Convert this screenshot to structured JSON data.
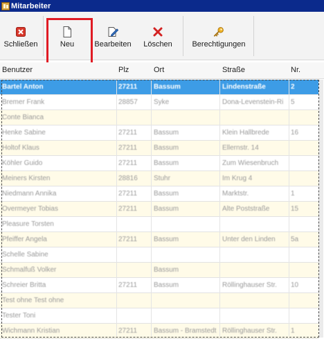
{
  "window": {
    "title": "Mitarbeiter"
  },
  "toolbar": {
    "close_label": "Schließen",
    "new_label": "Neu",
    "edit_label": "Bearbeiten",
    "delete_label": "Löschen",
    "permissions_label": "Berechtigungen"
  },
  "table": {
    "columns": [
      "Benutzer",
      "Plz",
      "Ort",
      "Straße",
      "Nr."
    ],
    "rows": [
      [
        "Bartel Anton",
        "27211",
        "Bassum",
        "Lindenstraße",
        "2"
      ],
      [
        "Bremer Frank",
        "28857",
        "Syke",
        "Dona-Levenstein-Ri",
        "5"
      ],
      [
        "Conte Bianca",
        "",
        "",
        "",
        ""
      ],
      [
        "Henke Sabine",
        "27211",
        "Bassum",
        "Klein Hallbrede",
        "16"
      ],
      [
        "Holtof Klaus",
        "27211",
        "Bassum",
        "Ellernstr. 14",
        ""
      ],
      [
        "Köhler Guido",
        "27211",
        "Bassum",
        "Zum Wiesenbruch",
        ""
      ],
      [
        "Meiners Kirsten",
        "28816",
        "Stuhr",
        "Im Krug 4",
        ""
      ],
      [
        "Niedmann Annika",
        "27211",
        "Bassum",
        "Marktstr.",
        "1"
      ],
      [
        "Overmeyer Tobias",
        "27211",
        "Bassum",
        "Alte Poststraße",
        "15"
      ],
      [
        "Pleasure Torsten",
        "",
        "",
        "",
        ""
      ],
      [
        "Pfeiffer Angela",
        "27211",
        "Bassum",
        "Unter den Linden",
        "5a"
      ],
      [
        "Schelle Sabine",
        "",
        "",
        "",
        ""
      ],
      [
        "Schmalfuß Volker",
        "",
        "Bassum",
        "",
        ""
      ],
      [
        "Schreier Britta",
        "27211",
        "Bassum",
        "Röllinghauser Str.",
        "10"
      ],
      [
        "Test ohne Test ohne",
        "",
        "",
        "",
        ""
      ],
      [
        "Tester Toni",
        "",
        "",
        "",
        ""
      ],
      [
        "Wichmann Kristian",
        "27211",
        "Bassum - Bramstedt",
        "Röllinghauser Str.",
        "1"
      ]
    ]
  },
  "colors": {
    "titlebar": "#0b2a8c",
    "selection": "#3d9ce6",
    "alt_row": "#fffbe8",
    "highlight": "#e01b24"
  }
}
